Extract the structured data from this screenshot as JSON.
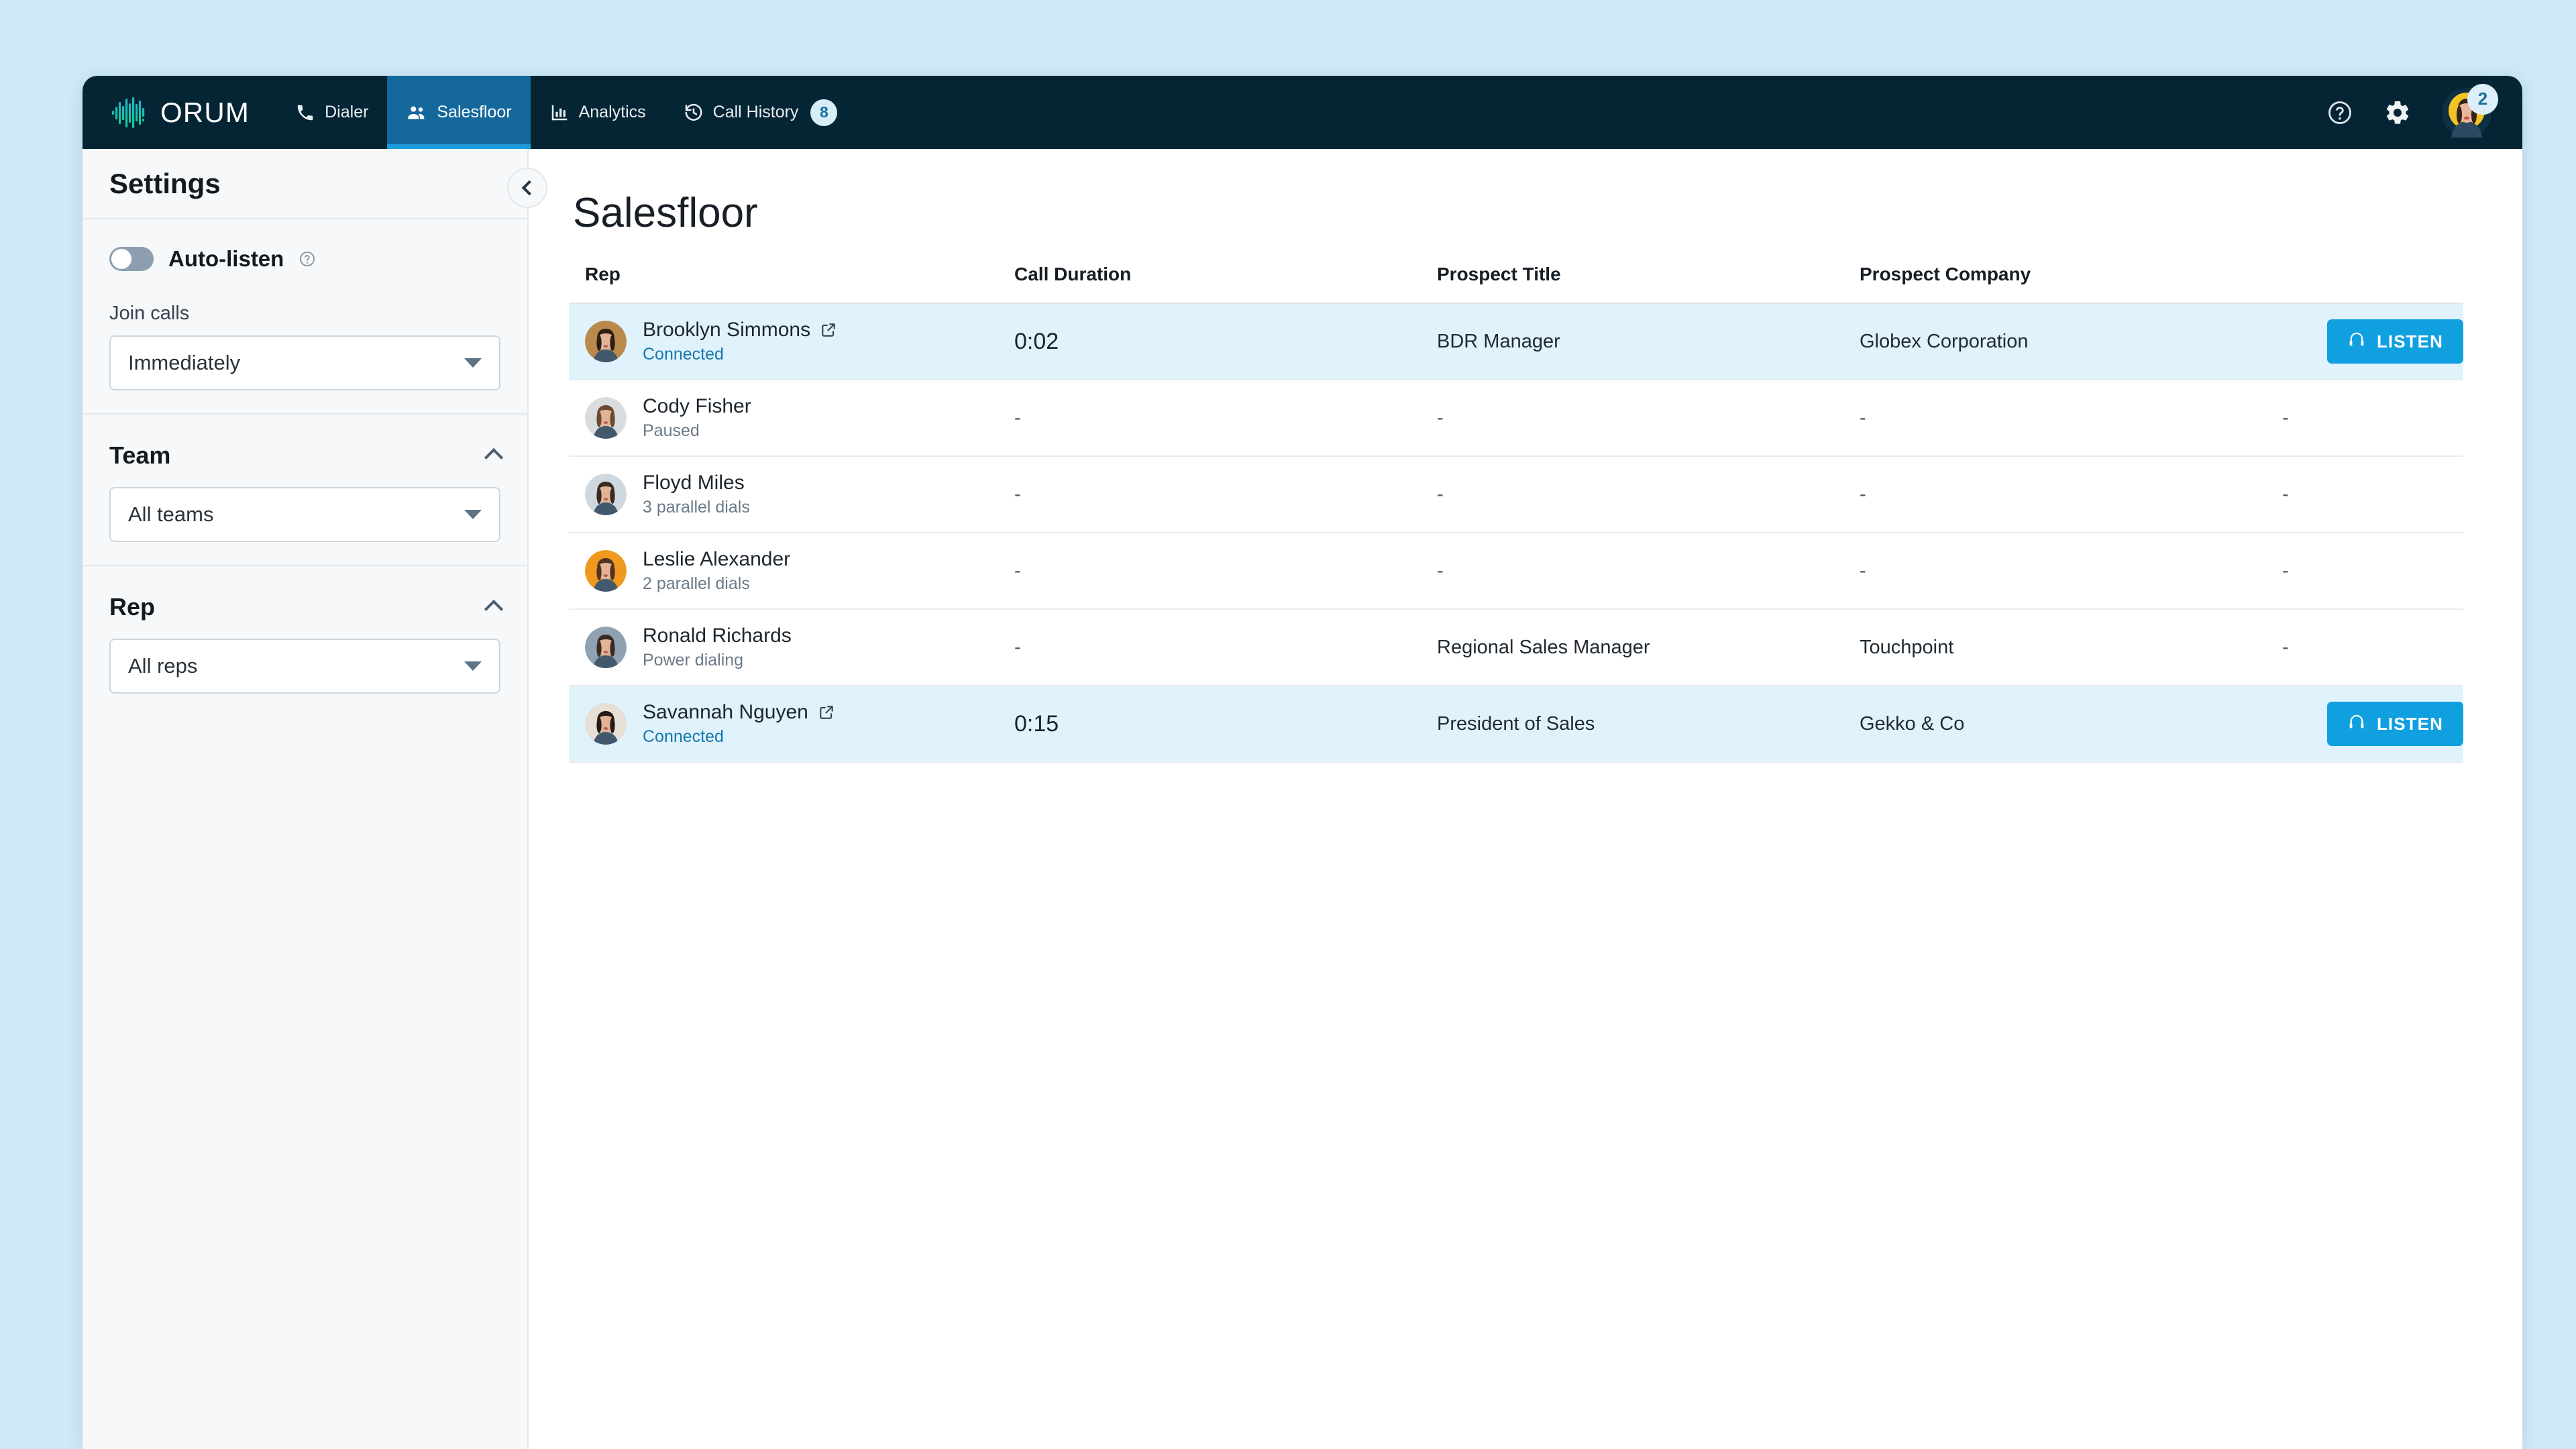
{
  "app": {
    "brand_name": "ORUM",
    "brand_logo_icon": "waveform-logo-icon"
  },
  "topnav": {
    "items": [
      {
        "label": "Dialer",
        "icon": "phone-icon",
        "active": false,
        "badge": null
      },
      {
        "label": "Salesfloor",
        "icon": "people-group-icon",
        "active": true,
        "badge": null
      },
      {
        "label": "Analytics",
        "icon": "bar-chart-icon",
        "active": false,
        "badge": null
      },
      {
        "label": "Call History",
        "icon": "history-clock-icon",
        "active": false,
        "badge": "8"
      }
    ],
    "help_icon": "question-circle-icon",
    "settings_icon": "gear-icon",
    "avatar_icon": "user-avatar",
    "avatar_badge": "2"
  },
  "sidebar": {
    "title": "Settings",
    "collapse_icon": "chevron-left-icon",
    "auto_listen": {
      "label": "Auto-listen",
      "help_icon": "question-circle-icon",
      "state": "off"
    },
    "join_calls": {
      "label": "Join calls",
      "value": "Immediately",
      "caret_icon": "chevron-down-icon"
    },
    "team": {
      "title": "Team",
      "collapse_icon": "chevron-up-icon",
      "value": "All teams",
      "caret_icon": "chevron-down-icon"
    },
    "rep": {
      "title": "Rep",
      "collapse_icon": "chevron-up-icon",
      "value": "All reps",
      "caret_icon": "chevron-down-icon"
    }
  },
  "main": {
    "page_title": "Salesfloor",
    "columns": [
      "Rep",
      "Call Duration",
      "Prospect Title",
      "Prospect Company",
      ""
    ],
    "listen_label": "LISTEN",
    "listen_icon": "headphones-icon",
    "external_link_icon": "external-link-icon",
    "rows": [
      {
        "name": "Brooklyn Simmons",
        "status": "Connected",
        "status_type": "connected",
        "has_link": true,
        "duration": "0:02",
        "prospect_title": "BDR Manager",
        "prospect_company": "Globex Corporation",
        "action": "LISTEN",
        "highlighted": true,
        "avatar_colors": [
          "#b98a4c",
          "#2a1d14"
        ]
      },
      {
        "name": "Cody Fisher",
        "status": "Paused",
        "status_type": "idle",
        "has_link": false,
        "duration": "-",
        "prospect_title": "-",
        "prospect_company": "-",
        "action": "-",
        "highlighted": false,
        "avatar_colors": [
          "#d9dde0",
          "#6b4a30"
        ]
      },
      {
        "name": "Floyd Miles",
        "status": "3 parallel dials",
        "status_type": "idle",
        "has_link": false,
        "duration": "-",
        "prospect_title": "-",
        "prospect_company": "-",
        "action": "-",
        "highlighted": false,
        "avatar_colors": [
          "#cfd8de",
          "#3b2a20"
        ]
      },
      {
        "name": "Leslie Alexander",
        "status": "2 parallel dials",
        "status_type": "idle",
        "has_link": false,
        "duration": "-",
        "prospect_title": "-",
        "prospect_company": "-",
        "action": "-",
        "highlighted": false,
        "avatar_colors": [
          "#f0991f",
          "#523223"
        ]
      },
      {
        "name": "Ronald Richards",
        "status": "Power dialing",
        "status_type": "idle",
        "has_link": false,
        "duration": "-",
        "prospect_title": "Regional Sales Manager",
        "prospect_company": "Touchpoint",
        "action": "-",
        "highlighted": false,
        "avatar_colors": [
          "#90a2b2",
          "#3a2a24"
        ]
      },
      {
        "name": "Savannah Nguyen",
        "status": "Connected",
        "status_type": "connected",
        "has_link": true,
        "duration": "0:15",
        "prospect_title": "President of Sales",
        "prospect_company": "Gekko & Co",
        "action": "LISTEN",
        "highlighted": true,
        "avatar_colors": [
          "#e7ded6",
          "#241a16"
        ]
      }
    ]
  },
  "colors": {
    "page_background": "#cfeaf7",
    "nav_background": "#062534",
    "nav_active": "#14689c",
    "nav_active_underline": "#1c9bdd",
    "accent_button": "#10a0e0",
    "row_highlight": "#e0f2fb",
    "connected_text": "#1578ad",
    "sidebar_background": "#f6f8fa"
  }
}
